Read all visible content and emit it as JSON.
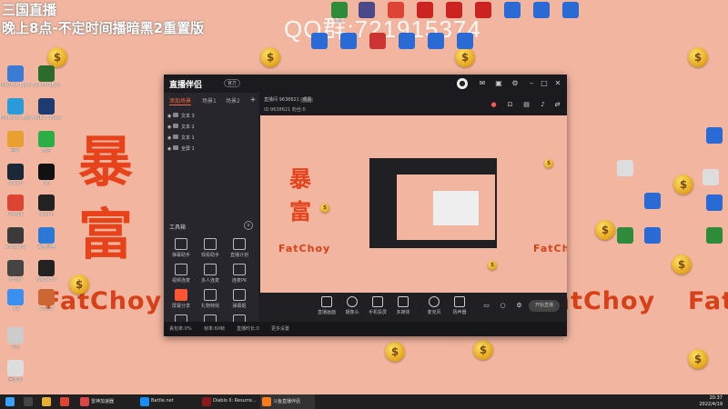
{
  "overlay": {
    "title": "三国直播",
    "subtitle": "晚上8点-不定时间播暗黑2重置版",
    "qq_group": "QQ群:721915374",
    "big_chars": [
      "暴",
      "富"
    ],
    "fatchoy": "FatChoy",
    "coin_symbol": "$"
  },
  "desktop_icons": [
    {
      "label": "Internet Explorer",
      "color": "#3a7bd5"
    },
    {
      "label": "SCRModEdit",
      "color": "#2b6b2b"
    },
    {
      "label": "Microsoft Edge",
      "color": "#2a9ad8"
    },
    {
      "label": "Adobe Photosh...",
      "color": "#1e3a6e"
    },
    {
      "label": "图片",
      "color": "#e8a030"
    },
    {
      "label": "微信",
      "color": "#2aae45"
    },
    {
      "label": "Steam",
      "color": "#1b2838"
    },
    {
      "label": "QQ",
      "color": "#111111"
    },
    {
      "label": "Google",
      "color": "#dd4433"
    },
    {
      "label": "Steam",
      "color": "#222222"
    },
    {
      "label": "soulgenp",
      "color": "#3a3a3a"
    },
    {
      "label": "百度网盘",
      "color": "#2a7ad5"
    },
    {
      "label": "amzer",
      "color": "#444444"
    },
    {
      "label": "WeGame",
      "color": "#222222"
    },
    {
      "label": "飞书",
      "color": "#3a8ff0"
    },
    {
      "label": "文件夹",
      "color": "#cc6633"
    },
    {
      "label": "文档",
      "color": "#cccccc"
    },
    {
      "label": "回收站",
      "color": "#dddddd"
    }
  ],
  "top_icons": [
    {
      "label": "360",
      "color": "#2e8b3a"
    },
    {
      "label": "",
      "color": "#4a4a8a"
    },
    {
      "label": "",
      "color": "#dd4433"
    },
    {
      "label": "",
      "color": "#cc2222"
    },
    {
      "label": "",
      "color": "#cc2222"
    },
    {
      "label": "",
      "color": "#cc2222"
    },
    {
      "label": "",
      "color": "#2a6ad5"
    },
    {
      "label": "",
      "color": "#2a6ad5"
    },
    {
      "label": "",
      "color": "#2a6ad5"
    },
    {
      "label": "",
      "color": "#2a6ad5"
    },
    {
      "label": "",
      "color": "#2a6ad5"
    },
    {
      "label": "",
      "color": "#cc3333"
    },
    {
      "label": "",
      "color": "#2a6ad5"
    },
    {
      "label": "",
      "color": "#2a6ad5"
    },
    {
      "label": "",
      "color": "#2a6ad5"
    }
  ],
  "app": {
    "name": "直播伴侣",
    "badge": "官方",
    "tabs": [
      "添加场景",
      "场景1",
      "场景2"
    ],
    "sources": [
      "文本 3",
      "文本 2",
      "文本 1",
      "全屏 1"
    ],
    "tools_title": "工具箱",
    "tools": [
      "弹幕助手",
      "观看助手",
      "直播计划",
      "视频连麦",
      "多人连麦",
      "连麦PK",
      "屏幕分享",
      "礼物特效",
      "弹幕姬",
      "小游戏",
      "直播间",
      "更多"
    ],
    "room_info": "直播间 9638621",
    "room_tag": "观看",
    "room_info2": "ID:9638621  粉丝:0",
    "bottom_buttons": [
      "直播画面",
      "摄像头",
      "手机投屏",
      "多媒体",
      "麦克风",
      "扬声器"
    ],
    "start_label": "开始直播",
    "status_items": [
      "丢包率:0%",
      "帧率:60帧",
      "直播时长:0",
      "更多设置"
    ]
  },
  "taskbar": {
    "items": [
      {
        "label": "雷神加速器",
        "color": "#d44"
      },
      {
        "label": "Battle.net",
        "color": "#148eff"
      },
      {
        "label": "Diablo II: Resurre...",
        "color": "#8b1a1a"
      },
      {
        "label": "斗鱼直播伴侣",
        "color": "#ff7a1a"
      }
    ],
    "time": "20:37",
    "date": "2022/4/19"
  }
}
